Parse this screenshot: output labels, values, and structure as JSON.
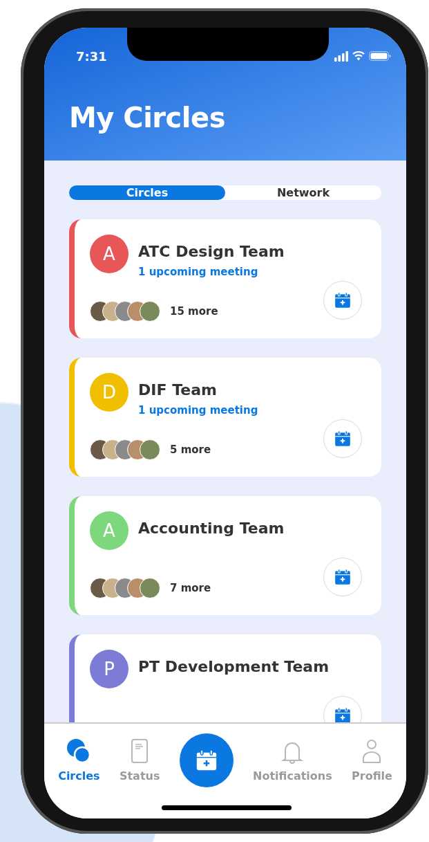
{
  "status_bar": {
    "time": "7:31"
  },
  "header": {
    "title": "My Circles"
  },
  "tabs": [
    {
      "label": "Circles",
      "selected": true
    },
    {
      "label": "Network",
      "selected": false
    }
  ],
  "circles": [
    {
      "initial": "A",
      "name": "ATC Design Team",
      "color": "#e85757",
      "meeting": "1 upcoming meeting",
      "more": "15 more"
    },
    {
      "initial": "D",
      "name": "DIF Team",
      "color": "#f0c000",
      "meeting": "1 upcoming meeting",
      "more": "5 more"
    },
    {
      "initial": "A",
      "name": "Accounting Team",
      "color": "#7dd87d",
      "more": "7 more"
    },
    {
      "initial": "P",
      "name": "PT Development Team",
      "color": "#7c7bd6"
    }
  ],
  "bottom_nav": [
    {
      "kind": "circles",
      "label": "Circles",
      "selected": true
    },
    {
      "kind": "status",
      "label": "Status",
      "selected": false
    },
    {
      "kind": "add"
    },
    {
      "kind": "bell",
      "label": "Notifications",
      "selected": false
    },
    {
      "kind": "profile",
      "label": "Profile",
      "selected": false
    }
  ]
}
